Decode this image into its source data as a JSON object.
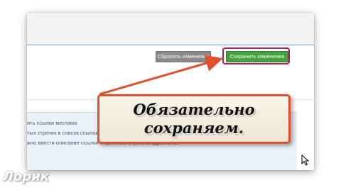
{
  "buttons": {
    "reset_label": "Сбросить изменения",
    "save_label": "Сохранить изменения"
  },
  "info": {
    "line1": "ять ссылки местами.",
    "line2": "тых строчек в список ссылок. Чтобы этим воспользоваться, введите \"-\" в это поле.",
    "line3": "жно ввести описание ссылки и при этом опустить адрес URL."
  },
  "callout": {
    "line1": "Обязательно",
    "line2": "сохраняем."
  },
  "watermark": "Лорик",
  "colors": {
    "save_button": "#46a141",
    "reset_button": "#8a8a8a",
    "highlight_border": "#c0185c",
    "arrow": "#e0502c",
    "callout_border": "#e0502c"
  },
  "icons": {
    "cursor": "mouse-pointer-icon",
    "arrow": "annotation-arrow"
  }
}
